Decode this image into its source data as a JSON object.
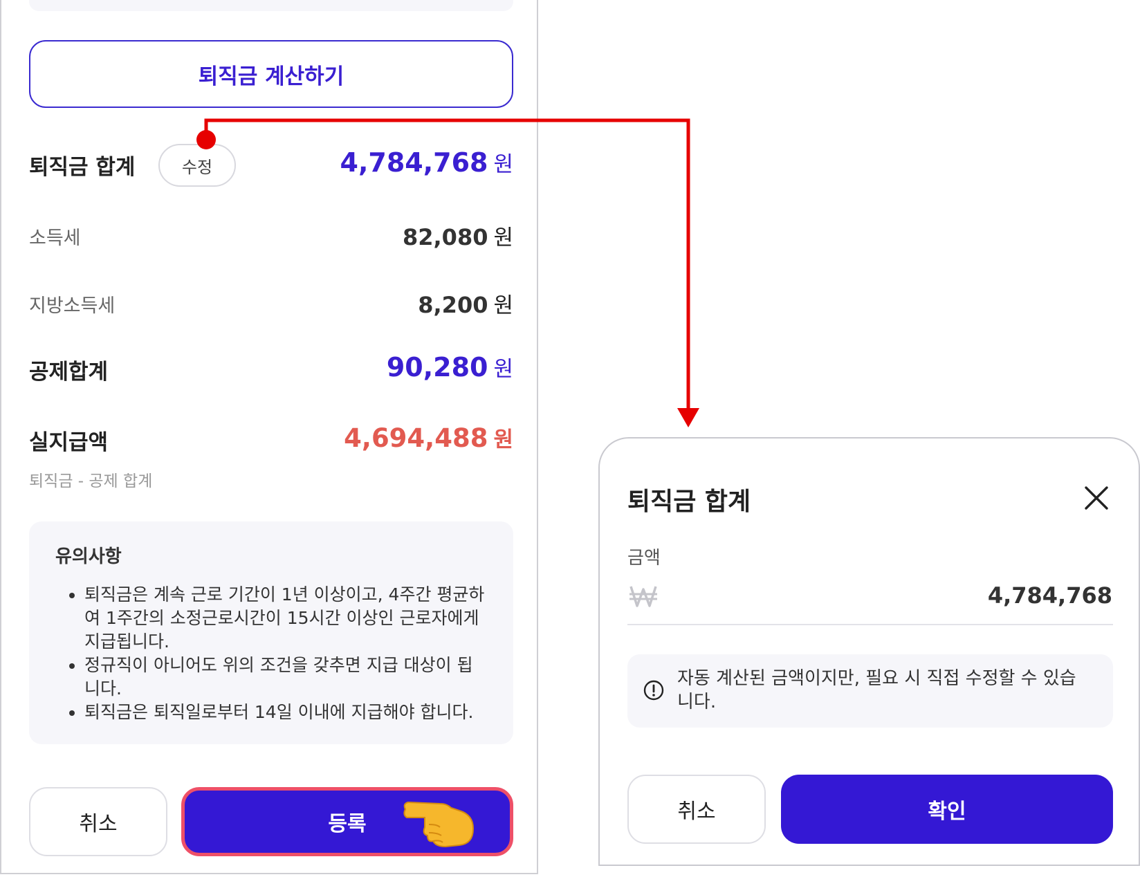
{
  "left": {
    "calc_button": "퇴직금 계산하기",
    "severance_total": {
      "label": "퇴직금 합계",
      "edit": "수정",
      "value": "4,784,768",
      "unit": "원"
    },
    "income_tax": {
      "label": "소득세",
      "value": "82,080",
      "unit": "원"
    },
    "local_tax": {
      "label": "지방소득세",
      "value": "8,200",
      "unit": "원"
    },
    "deduction_total": {
      "label": "공제합계",
      "value": "90,280",
      "unit": "원"
    },
    "net_pay": {
      "label": "실지급액",
      "value": "4,694,488",
      "unit": "원",
      "caption": "퇴직금 - 공제 합계"
    },
    "notice": {
      "title": "유의사항",
      "items": [
        "퇴직금은 계속 근로 기간이 1년 이상이고, 4주간 평균하여 1주간의 소정근로시간이 15시간 이상인 근로자에게 지급됩니다.",
        "정규직이 아니어도 위의 조건을 갖추면 지급 대상이 됩니다.",
        "퇴직금은 퇴직일로부터 14일 이내에 지급해야 합니다."
      ]
    },
    "cancel": "취소",
    "register": "등록"
  },
  "modal": {
    "title": "퇴직금 합계",
    "amount_label": "금액",
    "amount_value": "4,784,768",
    "info": "자동 계산된 금액이지만, 필요 시 직접 수정할 수 있습니다.",
    "cancel": "취소",
    "confirm": "확인"
  },
  "colors": {
    "accent": "#3418d4",
    "net_pay": "#e25a50",
    "annotation": "#e60000"
  },
  "icons": [
    "hand-pointer-icon",
    "close-icon",
    "won-icon",
    "info-icon"
  ]
}
